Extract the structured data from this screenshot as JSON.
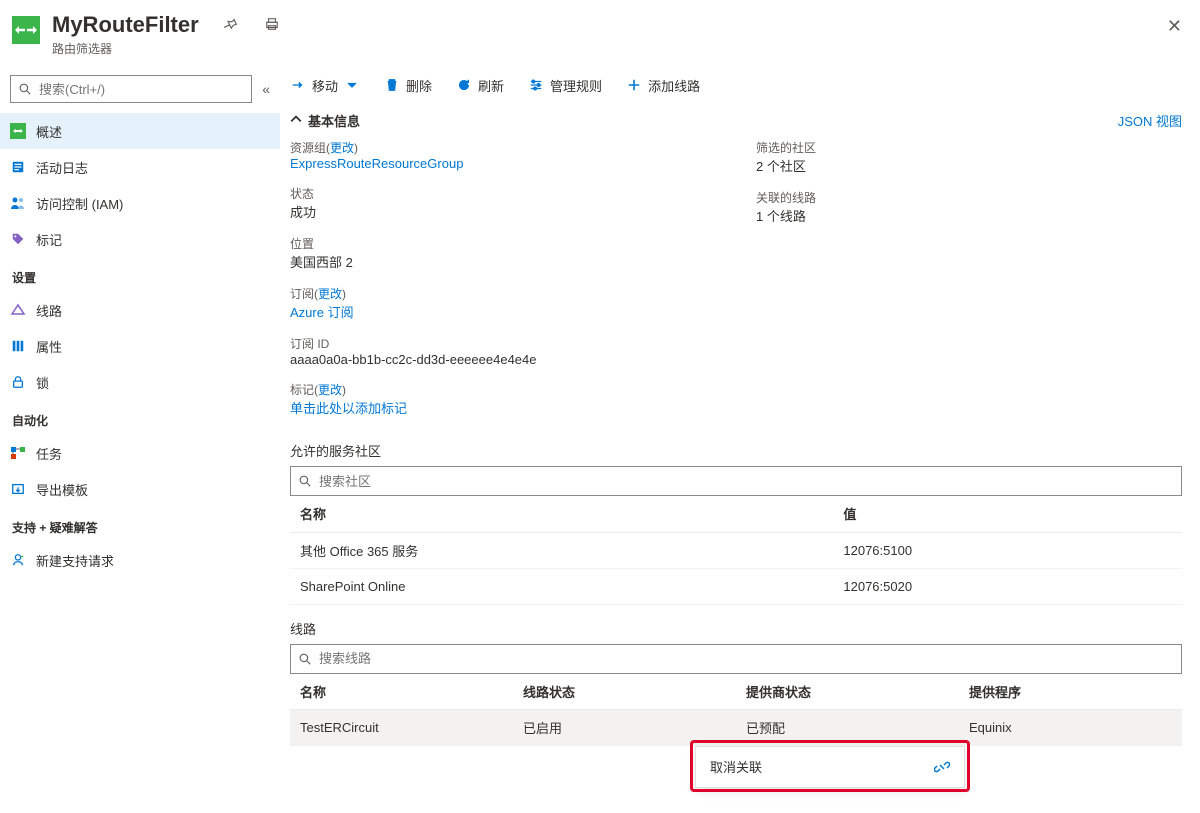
{
  "header": {
    "title": "MyRouteFilter",
    "subtitle": "路由筛选器"
  },
  "sidebar": {
    "search_placeholder": "搜索(Ctrl+/)",
    "groups": [
      {
        "label": "",
        "items": [
          {
            "label": "概述",
            "icon": "route"
          },
          {
            "label": "活动日志",
            "icon": "log"
          },
          {
            "label": "访问控制 (IAM)",
            "icon": "iam"
          },
          {
            "label": "标记",
            "icon": "tag"
          }
        ]
      },
      {
        "label": "设置",
        "items": [
          {
            "label": "线路",
            "icon": "circuit"
          },
          {
            "label": "属性",
            "icon": "props"
          },
          {
            "label": "锁",
            "icon": "lock"
          }
        ]
      },
      {
        "label": "自动化",
        "items": [
          {
            "label": "任务",
            "icon": "tasks"
          },
          {
            "label": "导出模板",
            "icon": "export"
          }
        ]
      },
      {
        "label": "支持 + 疑难解答",
        "items": [
          {
            "label": "新建支持请求",
            "icon": "support"
          }
        ]
      }
    ]
  },
  "toolbar": {
    "move": "移动",
    "delete": "删除",
    "refresh": "刷新",
    "managerules": "管理规则",
    "addcircuit": "添加线路"
  },
  "essentials": {
    "header": "基本信息",
    "json_link": "JSON 视图",
    "change": "更改",
    "left": {
      "rg_label": "资源组",
      "rg_value": "ExpressRouteResourceGroup",
      "status_label": "状态",
      "status_value": "成功",
      "location_label": "位置",
      "location_value": "美国西部 2",
      "sub_label": "订阅",
      "sub_value": "Azure 订阅",
      "subid_label": "订阅 ID",
      "subid_value": "aaaa0a0a-bb1b-cc2c-dd3d-eeeeee4e4e4e",
      "tags_label": "标记",
      "tags_value": "单击此处以添加标记"
    },
    "right": {
      "comm_label": "筛选的社区",
      "comm_value": "2 个社区",
      "assoc_label": "关联的线路",
      "assoc_value": "1 个线路"
    }
  },
  "communities": {
    "title": "允许的服务社区",
    "search_placeholder": "搜索社区",
    "columns": {
      "name": "名称",
      "value": "值"
    },
    "rows": [
      {
        "name": "其他 Office 365 服务",
        "value": "12076:5100"
      },
      {
        "name": "SharePoint Online",
        "value": "12076:5020"
      }
    ]
  },
  "circuits": {
    "title": "线路",
    "search_placeholder": "搜索线路",
    "columns": {
      "name": "名称",
      "cstatus": "线路状态",
      "pstatus": "提供商状态",
      "provider": "提供程序"
    },
    "rows": [
      {
        "name": "TestERCircuit",
        "cstatus": "已启用",
        "pstatus": "已预配",
        "provider": "Equinix"
      }
    ]
  },
  "context_menu": {
    "disassociate": "取消关联"
  }
}
